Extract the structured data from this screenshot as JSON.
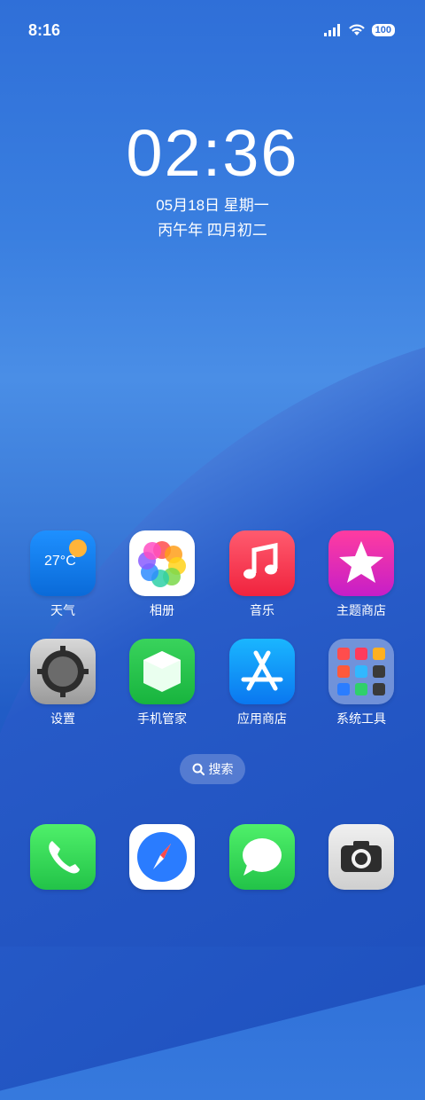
{
  "status_bar": {
    "time": "8:16",
    "battery": "100"
  },
  "lock_clock": {
    "time": "02:36",
    "date": "05月18日 星期一",
    "lunar": "丙午年 四月初二"
  },
  "apps": {
    "weather": {
      "label": "天气",
      "temp": "27°C"
    },
    "photos": {
      "label": "相册"
    },
    "music": {
      "label": "音乐"
    },
    "theme_store": {
      "label": "主题商店"
    },
    "settings": {
      "label": "设置"
    },
    "phone_manager": {
      "label": "手机管家"
    },
    "app_store": {
      "label": "应用商店"
    },
    "system_tools": {
      "label": "系统工具"
    }
  },
  "search": {
    "label": "搜索"
  },
  "dock": [
    {
      "name": "phone",
      "icon": "phone-icon"
    },
    {
      "name": "browser",
      "icon": "compass-icon"
    },
    {
      "name": "messages",
      "icon": "message-bubble-icon"
    },
    {
      "name": "camera",
      "icon": "camera-icon"
    }
  ]
}
